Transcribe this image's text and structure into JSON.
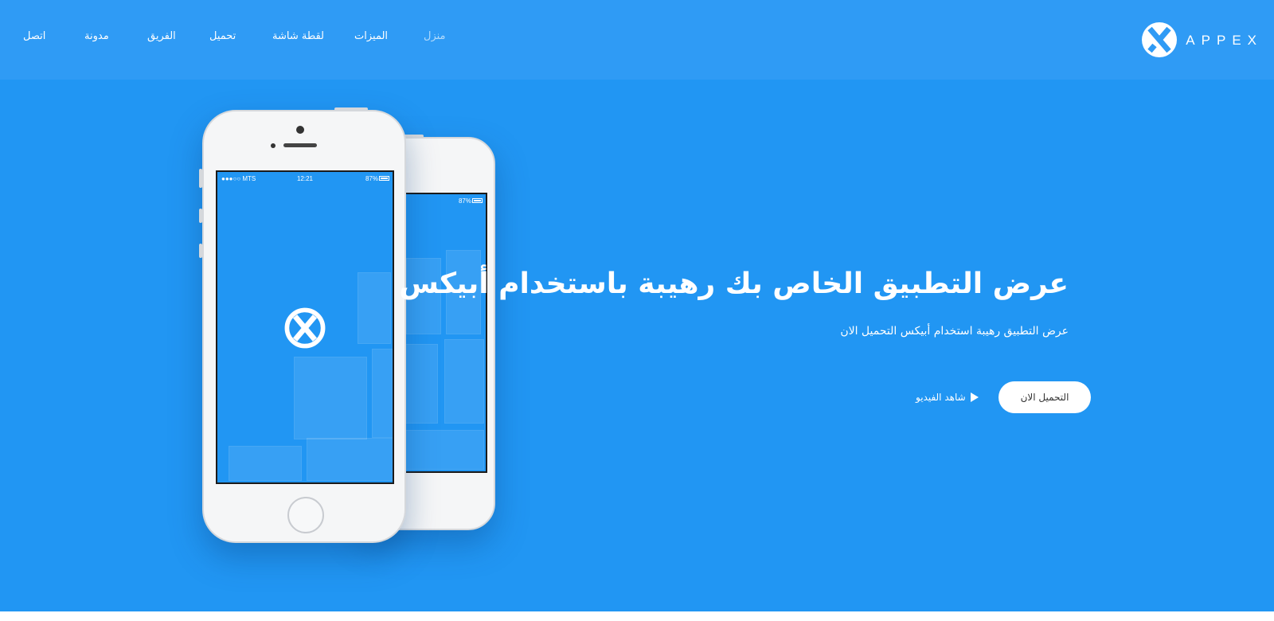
{
  "brand": {
    "name": "APPEX",
    "logo_icon": "appex-x-logo-icon"
  },
  "nav": {
    "items": [
      {
        "label": "منزل",
        "active": true
      },
      {
        "label": "الميزات",
        "active": false
      },
      {
        "label": "لقطة شاشة",
        "active": false
      },
      {
        "label": "تحميل",
        "active": false
      },
      {
        "label": "الفريق",
        "active": false
      },
      {
        "label": "مدونة",
        "active": false
      },
      {
        "label": "اتصل",
        "active": false
      }
    ]
  },
  "hero": {
    "title": "عرض التطبيق الخاص بك رهيبة باستخدام أبيكس",
    "subtitle": "عرض التطبيق رهيبة استخدام أبيكس التحميل الان",
    "download_label": "التحميل الان",
    "video_label": "شاهد الفيديو",
    "video_icon": "play-icon"
  },
  "phone": {
    "carrier": "●●●○○ MTS",
    "time": "12:21",
    "battery": "87%"
  },
  "colors": {
    "hero_bg": "#2196f3",
    "navbar_bg": "#2f9bf5",
    "text": "#ffffff",
    "button_bg": "#ffffff",
    "button_text": "#333333"
  }
}
